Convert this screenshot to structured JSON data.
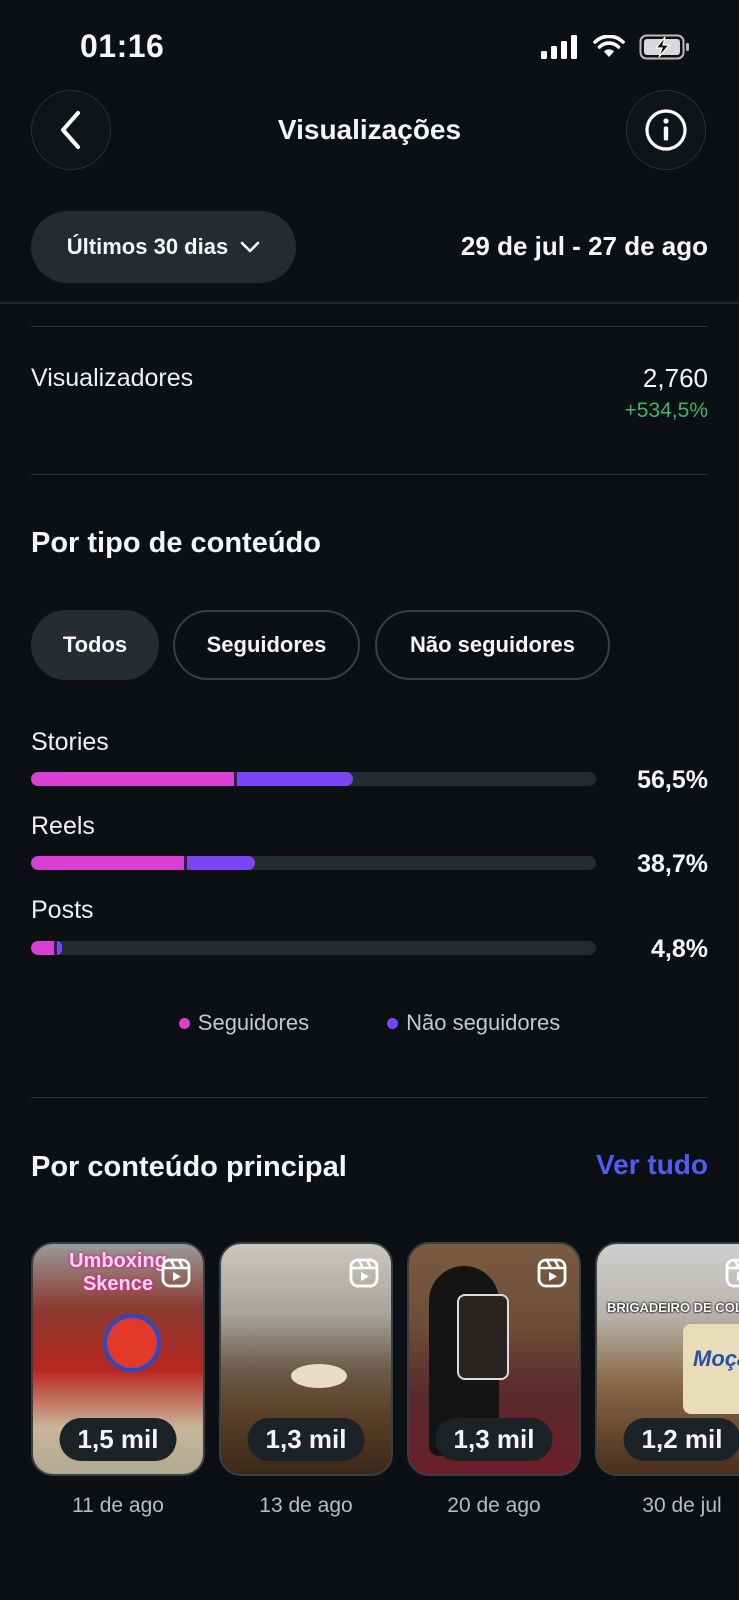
{
  "status_bar": {
    "time": "01:16"
  },
  "header": {
    "title": "Visualizações"
  },
  "filter": {
    "range_label": "Últimos 30 dias",
    "date_range": "29 de jul - 27 de ago"
  },
  "viewers": {
    "label": "Visualizadores",
    "value": "2,760",
    "change": "+534,5%"
  },
  "content_type": {
    "title": "Por tipo de conteúdo",
    "chips": [
      "Todos",
      "Seguidores",
      "Não seguidores"
    ],
    "active_chip": "Todos",
    "bars": [
      {
        "label": "Stories",
        "percent": "56,5%",
        "followers_fraction": 0.36,
        "non_followers_fraction": 0.205
      },
      {
        "label": "Reels",
        "percent": "38,7%",
        "followers_fraction": 0.27,
        "non_followers_fraction": 0.12
      },
      {
        "label": "Posts",
        "percent": "4,8%",
        "followers_fraction": 0.04,
        "non_followers_fraction": 0.008
      }
    ],
    "legend": [
      {
        "label": "Seguidores",
        "color": "#d93fd3"
      },
      {
        "label": "Não seguidores",
        "color": "#7a45f5"
      }
    ]
  },
  "top_content": {
    "title": "Por conteúdo principal",
    "see_all": "Ver tudo",
    "items": [
      {
        "views": "1,5 mil",
        "date": "11 de ago",
        "overlay": "Umboxing Skence"
      },
      {
        "views": "1,3 mil",
        "date": "13 de ago"
      },
      {
        "views": "1,3 mil",
        "date": "20 de ago"
      },
      {
        "views": "1,2 mil",
        "date": "30 de jul",
        "overlay": "BRIGADEIRO DE COLH",
        "overlay2": "Moça"
      }
    ]
  },
  "icons": {
    "back": "chevron-left-icon",
    "info": "info-icon",
    "dropdown": "chevron-down-icon",
    "reel": "reel-icon"
  }
}
